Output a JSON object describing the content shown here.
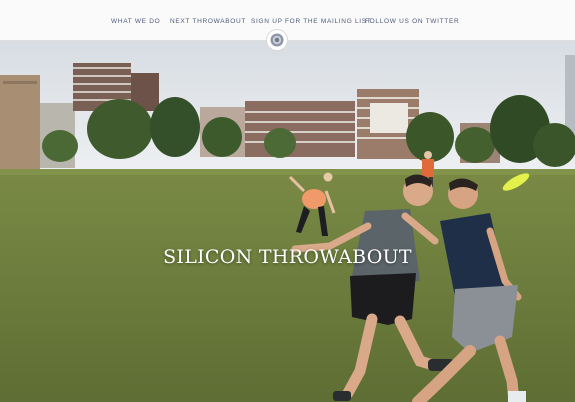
{
  "nav": {
    "items": [
      {
        "label": "WHAT WE DO"
      },
      {
        "label": "NEXT THROWABOUT"
      },
      {
        "label": "SIGN UP FOR THE MAILING LIST"
      },
      {
        "label": "FOLLOW US ON TWITTER"
      }
    ]
  },
  "logo": {
    "icon": "frisbee-logo-icon"
  },
  "hero": {
    "title": "SILICON THROWABOUT",
    "image": "hero-photo"
  },
  "colors": {
    "nav_text": "#4e5a7a",
    "topbar_bg": "#fafafa",
    "grass": "#6f7f3f",
    "frisbee": "#e3f14a"
  }
}
